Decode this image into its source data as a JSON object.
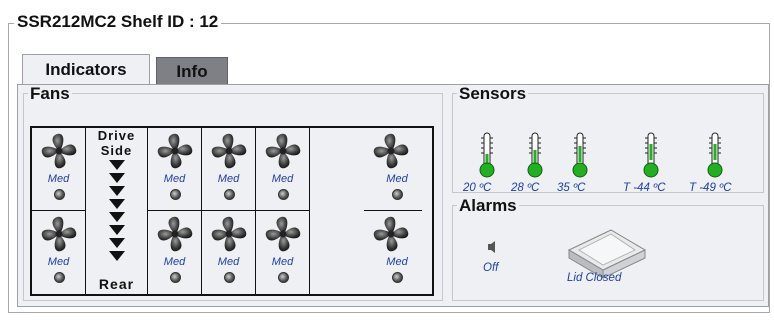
{
  "shelf": {
    "title": "SSR212MC2 Shelf ID : 12"
  },
  "tabs": [
    {
      "label": "Indicators",
      "active": true
    },
    {
      "label": "Info",
      "active": false
    }
  ],
  "fans": {
    "title": "Fans",
    "top_row": [
      "Med",
      "Med",
      "Med",
      "Med",
      "Med"
    ],
    "bottom_row": [
      "Med",
      "Med",
      "Med",
      "Med",
      "Med"
    ],
    "drive_top_label_1": "Drive",
    "drive_top_label_2": "Side",
    "drive_bottom_label": "Rear"
  },
  "sensors": {
    "title": "Sensors",
    "readings": [
      "20 ºC",
      "28 ºC",
      "35 ºC",
      "T -44 ºC",
      "T -49 ºC"
    ],
    "color": "#22b022"
  },
  "alarms": {
    "title": "Alarms",
    "speaker_label": "Off",
    "lid_label": "Lid Closed"
  },
  "colors": {
    "accent_text": "#1f3fa8",
    "active_tab": "#eef0f3",
    "inactive_tab": "#7e8086"
  }
}
